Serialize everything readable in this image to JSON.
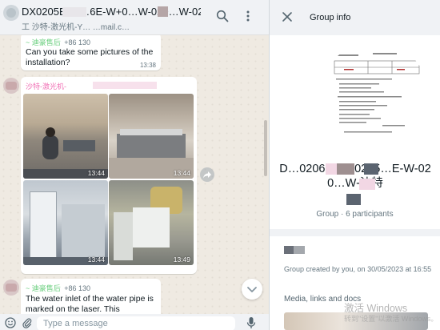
{
  "chat": {
    "title": "DX0205E-W…6E-W+0…W-020…W-02…",
    "subtitle": "工 沙特-激光机-Y… …mail.c…",
    "messages": [
      {
        "sender": "~ 迪豪售后",
        "phone": "+86 130",
        "text": "Can you take some pictures of the installation?",
        "time": "13:38"
      },
      {
        "sender": "沙特-激光机-",
        "photos": [
          {
            "time": "13:44"
          },
          {
            "time": "13:44"
          },
          {
            "time": "13:44"
          },
          {
            "time": "13:49"
          }
        ]
      },
      {
        "sender": "~ 迪豪售后",
        "phone": "+86 130",
        "text": "The water inlet of the water pipe is marked on the laser. This connection"
      }
    ],
    "composer": {
      "placeholder": "Type a message"
    },
    "icons": {
      "search": "search-icon",
      "menu": "kebab-menu-icon",
      "emoji": "emoji-icon",
      "attach": "paperclip-icon",
      "mic": "microphone-icon",
      "forward": "forward-icon",
      "scroll_down": "chevron-down-icon"
    }
  },
  "info": {
    "title": "Group info",
    "group_name": "D…0206E-W+0205…E-W-020…W-沙特",
    "meta": "Group · 6 participants",
    "created": "Group created by you, on 30/05/2023 at 16:55",
    "media_label": "Media, links and docs",
    "icons": {
      "close": "close-icon"
    }
  },
  "watermark": {
    "line1": "激活 Windows",
    "line2": "转到\"设置\"以激活 Windows。"
  },
  "colors": {
    "chat_bg": "#efeae2",
    "header_bg": "#f0f2f5",
    "bubble_bg": "#ffffff",
    "sender_green": "#6bcf7f",
    "sender_pink": "#f06fb4",
    "muted_text": "#667781"
  }
}
